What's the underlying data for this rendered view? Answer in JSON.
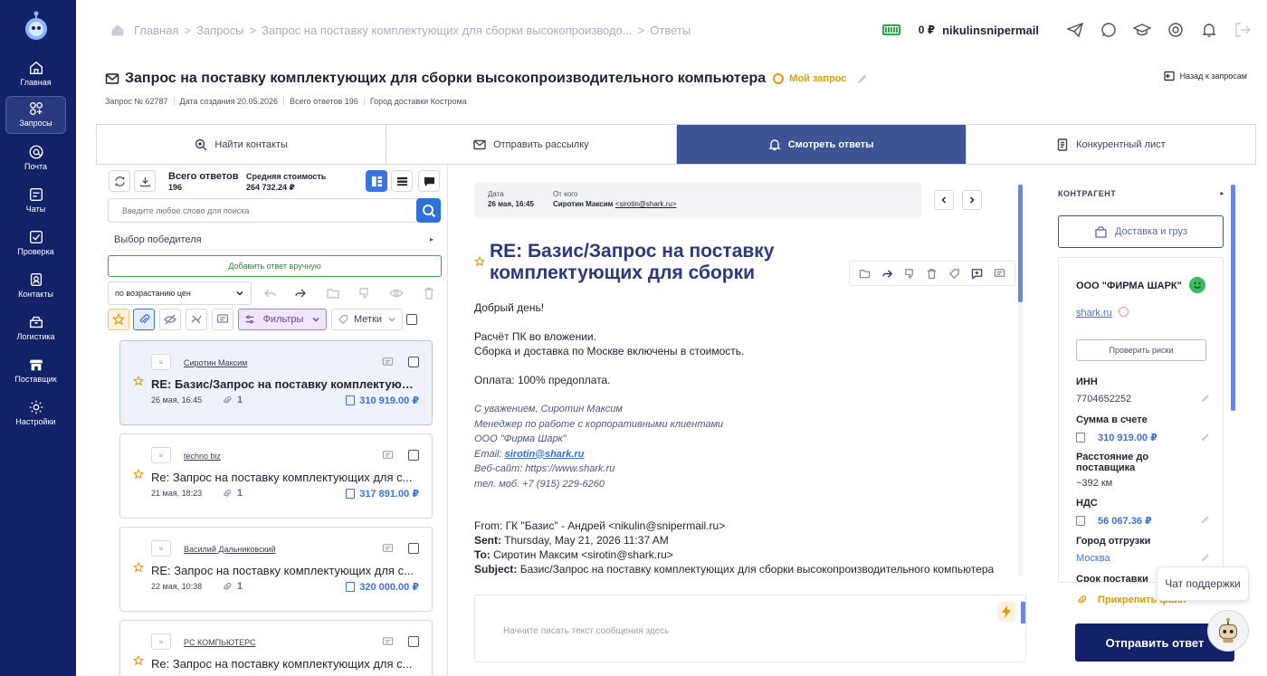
{
  "sidebar": {
    "items": [
      {
        "label": "Главная",
        "icon": "home-icon"
      },
      {
        "label": "Запросы",
        "icon": "requests-icon",
        "active": true
      },
      {
        "label": "Почта",
        "icon": "at-icon"
      },
      {
        "label": "Чаты",
        "icon": "chat-icon"
      },
      {
        "label": "Проверка",
        "icon": "check-icon"
      },
      {
        "label": "Контакты",
        "icon": "contacts-icon"
      },
      {
        "label": "Логистика",
        "icon": "logistics-icon"
      },
      {
        "label": "Поставщик",
        "icon": "store-icon"
      },
      {
        "label": "Настройки",
        "icon": "gear-icon"
      }
    ]
  },
  "breadcrumb": {
    "items": [
      "Главная",
      "Запросы",
      "Запрос на поставку комплектующих для сборки высокопроизводо...",
      "Ответы"
    ]
  },
  "topbar": {
    "balance": "0 ₽",
    "username": "nikulinsnipermail"
  },
  "request": {
    "title": "Запрос на поставку комплектующих для сборки высокопроизводительного компьютера",
    "my_request": "Мой запрос",
    "back_label": "Назад к запросам",
    "meta": [
      "Запрос № 62787",
      "Дата создания 20.05.2026",
      "Всего ответов 196",
      "Город доставки Кострома"
    ]
  },
  "tabs": [
    {
      "label": "Найти контакты",
      "icon": "search-plus-icon"
    },
    {
      "label": "Отправить рассылку",
      "icon": "mail-icon"
    },
    {
      "label": "Смотреть ответы",
      "icon": "bell-icon",
      "active": true
    },
    {
      "label": "Конкурентный лист",
      "icon": "document-icon"
    }
  ],
  "list": {
    "total_label": "Всего ответов",
    "total_value": "196",
    "avg_label": "Средняя стоимость",
    "avg_value": "264 732.24 ₽",
    "search_placeholder": "Введите любое слово для поиска",
    "winner_label": "Выбор победителя",
    "add_manual_label": "Добавить ответ вручную",
    "sort_label": "по возрастанию цен",
    "filters_label": "Фильтры",
    "tags_label": "Метки",
    "items": [
      {
        "sender": "Сиротин Максим",
        "subject": "RE: Базис/Запрос на поставку комплектующ...",
        "date": "26 мая, 16:45",
        "attachments": "1",
        "price": "310 919.00 ₽"
      },
      {
        "sender": "techno biz",
        "subject": "Re: Запрос на поставку комплектующих для с...",
        "date": "21 мая, 18:23",
        "attachments": "1",
        "price": "317 891.00 ₽"
      },
      {
        "sender": "Василий Дальниковский",
        "subject": "RE: Запрос на поставку комплектующих для с...",
        "date": "22 мая, 10:38",
        "attachments": "1",
        "price": "320 000.00 ₽"
      },
      {
        "sender": "PC КОМПЬЮТЕРС",
        "subject": "Re: Запрос на поставку комплектующих для с...",
        "date": "",
        "attachments": "",
        "price": ""
      }
    ]
  },
  "mail": {
    "date_label": "Дата",
    "date_value": "26 мая, 16:45",
    "from_label": "От кого",
    "from_name": "Сиротин Максим",
    "from_email": "<sirotin@shark.ru>",
    "subject": "RE: Базис/Запрос на поставку комплектующих для сборки",
    "greeting": "Добрый день!",
    "line1": "Расчёт ПК во вложении.",
    "line2": "Сборка и доставка по Москве включены в стоимость.",
    "line3": "Оплата: 100% предоплата.",
    "sig1": "С уважением, Сиротин Максим",
    "sig2": "Менеджер по работе с корпоративными клиентами",
    "sig3": "ООО \"Фирма Шарк\"",
    "sig4_label": "Email:",
    "sig4_email": "sirotin@shark.ru",
    "sig5": "Веб-сайт: https://www.shark.ru",
    "sig6": "тел. моб. +7 (915) 229-6260",
    "q_from": "From: ГК \"Базис\" - Андрей <nikulin@snipermail.ru>",
    "q_sent_label": "Sent:",
    "q_sent": "Thursday, May 21, 2026 11:37 AM",
    "q_to_label": "To:",
    "q_to": "Сиротин Максим <sirotin@shark.ru>",
    "q_subject_label": "Subject:",
    "q_subject": "Базис/Запрос на поставку комплектующих для сборки высокопроизводительного компьютера",
    "compose_placeholder": "Начните писать текст сообщения здесь"
  },
  "contractor": {
    "header": "КОНТРАГЕНТ",
    "delivery_btn": "Доставка и груз",
    "org": "ООО \"ФИРМА ШАРК\"",
    "site": "shark.ru",
    "risk_btn": "Проверить риски",
    "inn_label": "ИНН",
    "inn_value": "7704652252",
    "sum_label": "Сумма в счете",
    "sum_value": "310 919.00 ₽",
    "dist_label": "Расстояние до поставщика",
    "dist_value": "~392 км",
    "vat_label": "НДС",
    "vat_value": "56 067.36 ₽",
    "city_label": "Город отгрузки",
    "city_value": "Москва",
    "next_label": "Срок поставки",
    "attach_label": "Прикрепить файл",
    "send_label": "Отправить ответ"
  },
  "support": {
    "label": "Чат поддержки"
  }
}
